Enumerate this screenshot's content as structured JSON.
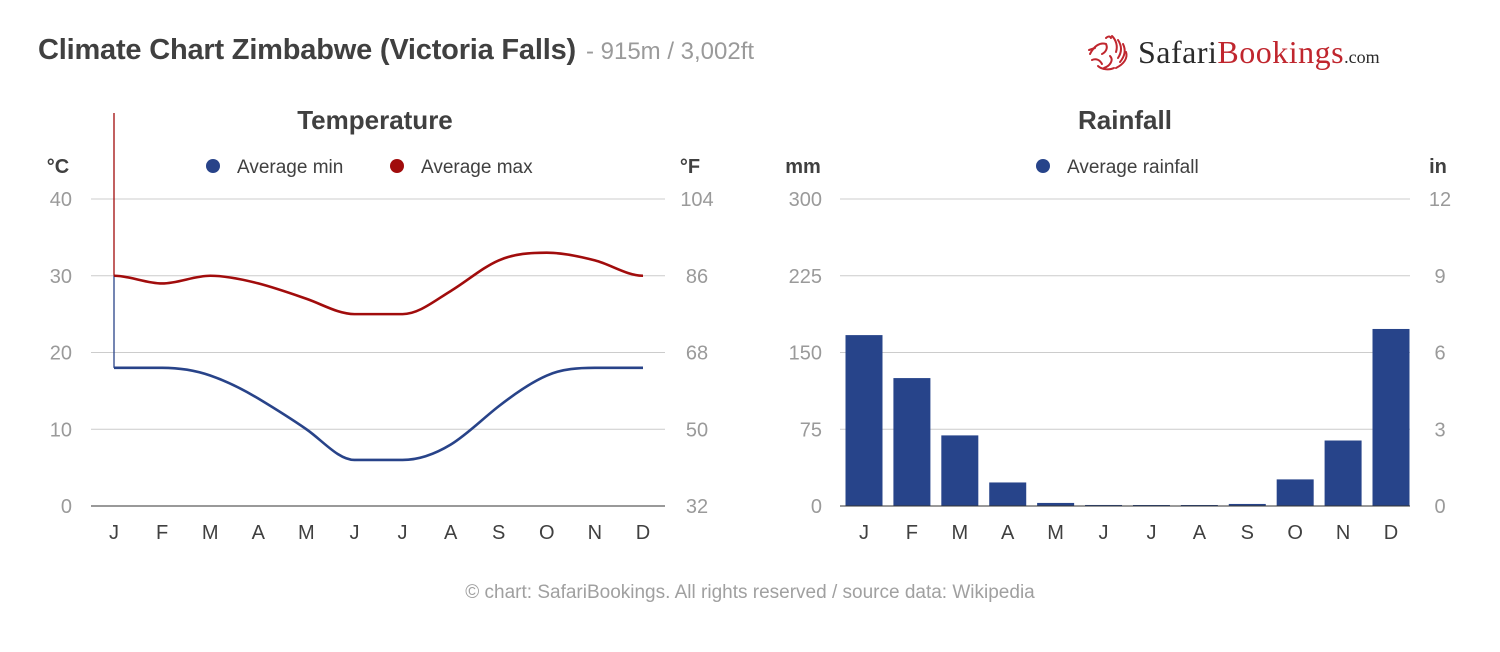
{
  "header": {
    "title": "Climate Chart Zimbabwe (Victoria Falls)",
    "subtitle": "- 915m / 3,002ft"
  },
  "logo": {
    "part1": "Safari",
    "part2": "Bookings",
    "part3": ".com",
    "icon": "lion-head-icon",
    "colors": {
      "dark": "#2b2b2b",
      "red": "#c0262e"
    }
  },
  "footer": {
    "text": "© chart: SafariBookings. All rights reserved / source data: Wikipedia"
  },
  "chart_data": [
    {
      "type": "line",
      "title": "Temperature",
      "left_axis_label": "°C",
      "right_axis_label": "°F",
      "categories": [
        "J",
        "F",
        "M",
        "A",
        "M",
        "J",
        "J",
        "A",
        "S",
        "O",
        "N",
        "D"
      ],
      "ylim": [
        0,
        40
      ],
      "left_ticks": [
        "0",
        "10",
        "20",
        "30",
        "40"
      ],
      "right_ticks": [
        "32",
        "50",
        "68",
        "86",
        "104"
      ],
      "grid": true,
      "legend": "top-center",
      "series": [
        {
          "name": "Average min",
          "color": "#284389",
          "values": [
            18,
            18,
            17,
            14,
            10,
            6,
            6,
            8,
            13,
            17,
            18,
            18
          ]
        },
        {
          "name": "Average max",
          "color": "#a10c0c",
          "values": [
            30,
            29,
            30,
            29,
            27,
            25,
            25,
            28,
            32,
            33,
            32,
            30
          ]
        }
      ]
    },
    {
      "type": "bar",
      "title": "Rainfall",
      "left_axis_label": "mm",
      "right_axis_label": "in",
      "categories": [
        "J",
        "F",
        "M",
        "A",
        "M",
        "J",
        "J",
        "A",
        "S",
        "O",
        "N",
        "D"
      ],
      "ylim": [
        0,
        300
      ],
      "left_ticks": [
        "0",
        "75",
        "150",
        "225",
        "300"
      ],
      "right_ticks": [
        "0",
        "3",
        "6",
        "9",
        "12"
      ],
      "grid": true,
      "legend": "top-center",
      "series": [
        {
          "name": "Average rainfall",
          "color": "#27448a",
          "values": [
            167,
            125,
            69,
            23,
            3,
            1,
            0,
            0,
            2,
            26,
            64,
            173
          ]
        }
      ]
    }
  ]
}
